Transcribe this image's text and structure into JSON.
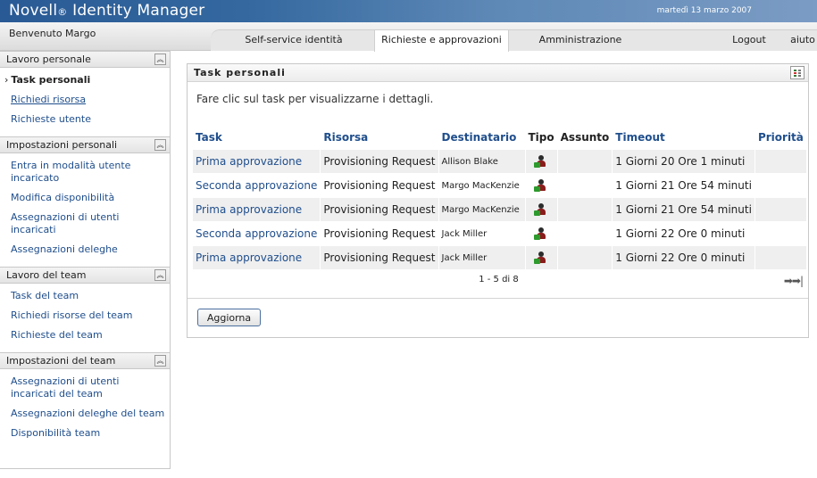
{
  "header": {
    "brand": "Novell",
    "reg_mark": "®",
    "product": " Identity Manager",
    "date": "martedì 13 marzo 2007"
  },
  "nav": {
    "welcome": "Benvenuto Margo",
    "tabs": [
      {
        "label": "Self-service identità"
      },
      {
        "label": "Richieste e approvazioni",
        "active": true
      },
      {
        "label": "Amministrazione"
      },
      {
        "label": "Logout"
      },
      {
        "label": "aiuto"
      }
    ]
  },
  "sidebar": {
    "sections": [
      {
        "title": "Lavoro personale",
        "items": [
          "Task personali",
          "Richiedi risorsa",
          "Richieste utente"
        ]
      },
      {
        "title": "Impostazioni personali",
        "items": [
          "Entra in modalità utente incaricato",
          "Modifica disponibilità",
          "Assegnazioni di utenti incaricati",
          "Assegnazioni deleghe"
        ]
      },
      {
        "title": "Lavoro del team",
        "items": [
          "Task del team",
          "Richiedi risorse del team",
          "Richieste del team"
        ]
      },
      {
        "title": "Impostazioni del team",
        "items": [
          "Assegnazioni di utenti incaricati del team",
          "Assegnazioni deleghe del team",
          "Disponibilità team"
        ]
      }
    ],
    "collapse_glyph": "︽"
  },
  "panel": {
    "title": "Task personali",
    "intro": "Fare clic sul task per visualizzarne i dettagli.",
    "columns": [
      "Task",
      "Risorsa",
      "Destinatario",
      "Tipo",
      "Assunto",
      "Timeout",
      "Priorità"
    ],
    "rows": [
      {
        "task": "Prima approvazione",
        "resource": "Provisioning Request",
        "recipient": "Allison Blake",
        "timeout": "1 Giorni 20 Ore 1 minuti"
      },
      {
        "task": "Seconda approvazione",
        "resource": "Provisioning Request",
        "recipient": "Margo MacKenzie",
        "timeout": "1 Giorni 21 Ore 54 minuti"
      },
      {
        "task": "Prima approvazione",
        "resource": "Provisioning Request",
        "recipient": "Margo MacKenzie",
        "timeout": "1 Giorni 21 Ore 54 minuti"
      },
      {
        "task": "Seconda approvazione",
        "resource": "Provisioning Request",
        "recipient": "Jack Miller",
        "timeout": "1 Giorni 22 Ore 0 minuti"
      },
      {
        "task": "Prima approvazione",
        "resource": "Provisioning Request",
        "recipient": "Jack Miller",
        "timeout": "1 Giorni 22 Ore 0 minuti"
      }
    ],
    "pager_text": "1 - 5 di 8",
    "refresh_label": "Aggiorna"
  }
}
